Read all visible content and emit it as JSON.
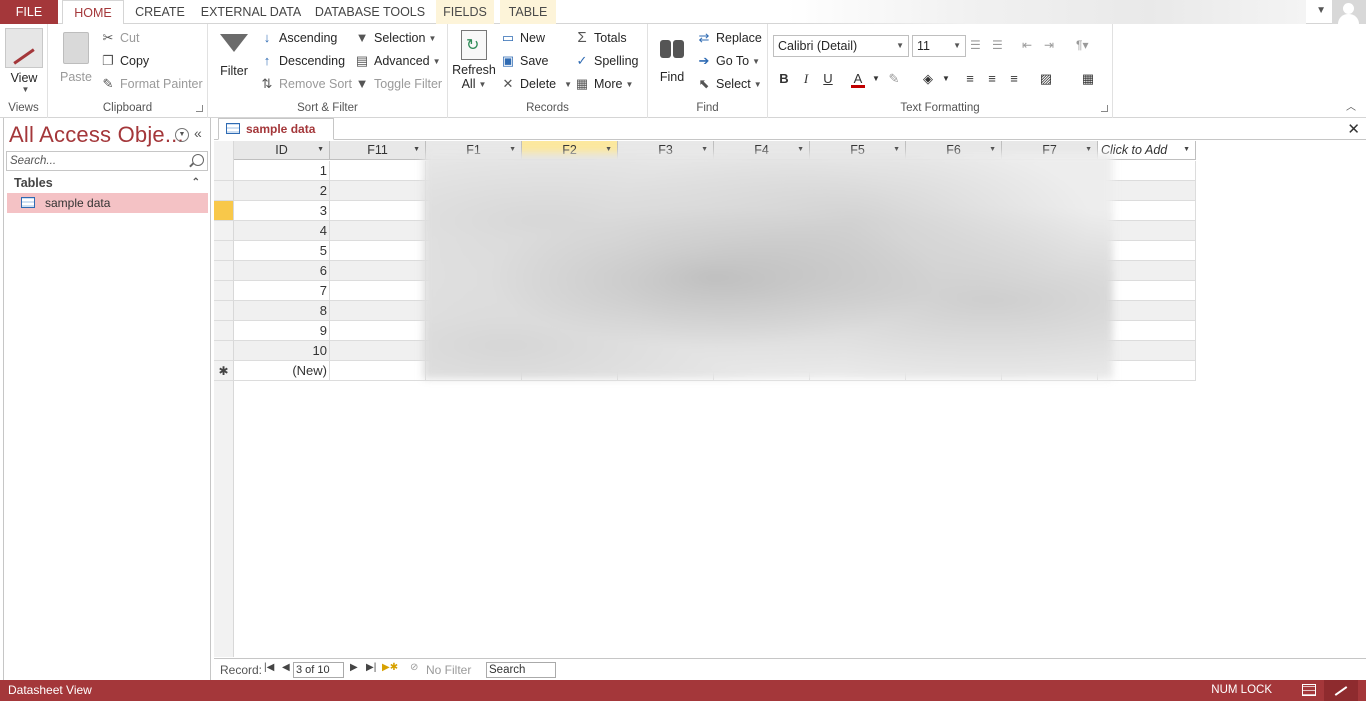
{
  "tabs": {
    "file": "FILE",
    "home": "HOME",
    "create": "CREATE",
    "external": "EXTERNAL DATA",
    "dbtools": "DATABASE TOOLS",
    "fields": "FIELDS",
    "table": "TABLE"
  },
  "ribbon": {
    "views": {
      "view": "View",
      "label": "Views"
    },
    "clipboard": {
      "paste": "Paste",
      "cut": "Cut",
      "copy": "Copy",
      "format_painter": "Format Painter",
      "label": "Clipboard"
    },
    "sort_filter": {
      "filter": "Filter",
      "ascending": "Ascending",
      "descending": "Descending",
      "remove_sort": "Remove Sort",
      "selection": "Selection",
      "advanced": "Advanced",
      "toggle_filter": "Toggle Filter",
      "label": "Sort & Filter"
    },
    "records": {
      "refresh": "Refresh",
      "refresh_all": "All",
      "new": "New",
      "save": "Save",
      "delete": "Delete",
      "totals": "Totals",
      "spelling": "Spelling",
      "more": "More",
      "label": "Records"
    },
    "find": {
      "find": "Find",
      "replace": "Replace",
      "goto": "Go To",
      "select": "Select",
      "label": "Find"
    },
    "text_formatting": {
      "font": "Calibri (Detail)",
      "size": "11",
      "bold": "B",
      "italic": "I",
      "underline": "U",
      "font_color": "A",
      "label": "Text Formatting"
    }
  },
  "nav": {
    "title": "All Access Obje...",
    "search_placeholder": "Search...",
    "group": "Tables",
    "items": [
      "sample data"
    ]
  },
  "document": {
    "tab": "sample data",
    "columns": [
      {
        "name": "ID",
        "active": false
      },
      {
        "name": "F11",
        "active": false
      },
      {
        "name": "F1",
        "active": false
      },
      {
        "name": "F2",
        "active": true
      },
      {
        "name": "F3",
        "active": false
      },
      {
        "name": "F4",
        "active": false
      },
      {
        "name": "F5",
        "active": false
      },
      {
        "name": "F6",
        "active": false
      },
      {
        "name": "F7",
        "active": false
      }
    ],
    "add_column": "Click to Add",
    "rows": [
      "1",
      "2",
      "3",
      "4",
      "5",
      "6",
      "7",
      "8",
      "9",
      "10"
    ],
    "new_row": "(New)",
    "current_row": 3
  },
  "record_nav": {
    "label": "Record:",
    "position": "3 of 10",
    "no_filter": "No Filter",
    "search": "Search"
  },
  "status": {
    "view": "Datasheet View",
    "numlock": "NUM LOCK"
  },
  "colors": {
    "accent": "#a4373a",
    "selected_header": "#fce89e",
    "nav_selected": "#f4c2c5"
  }
}
